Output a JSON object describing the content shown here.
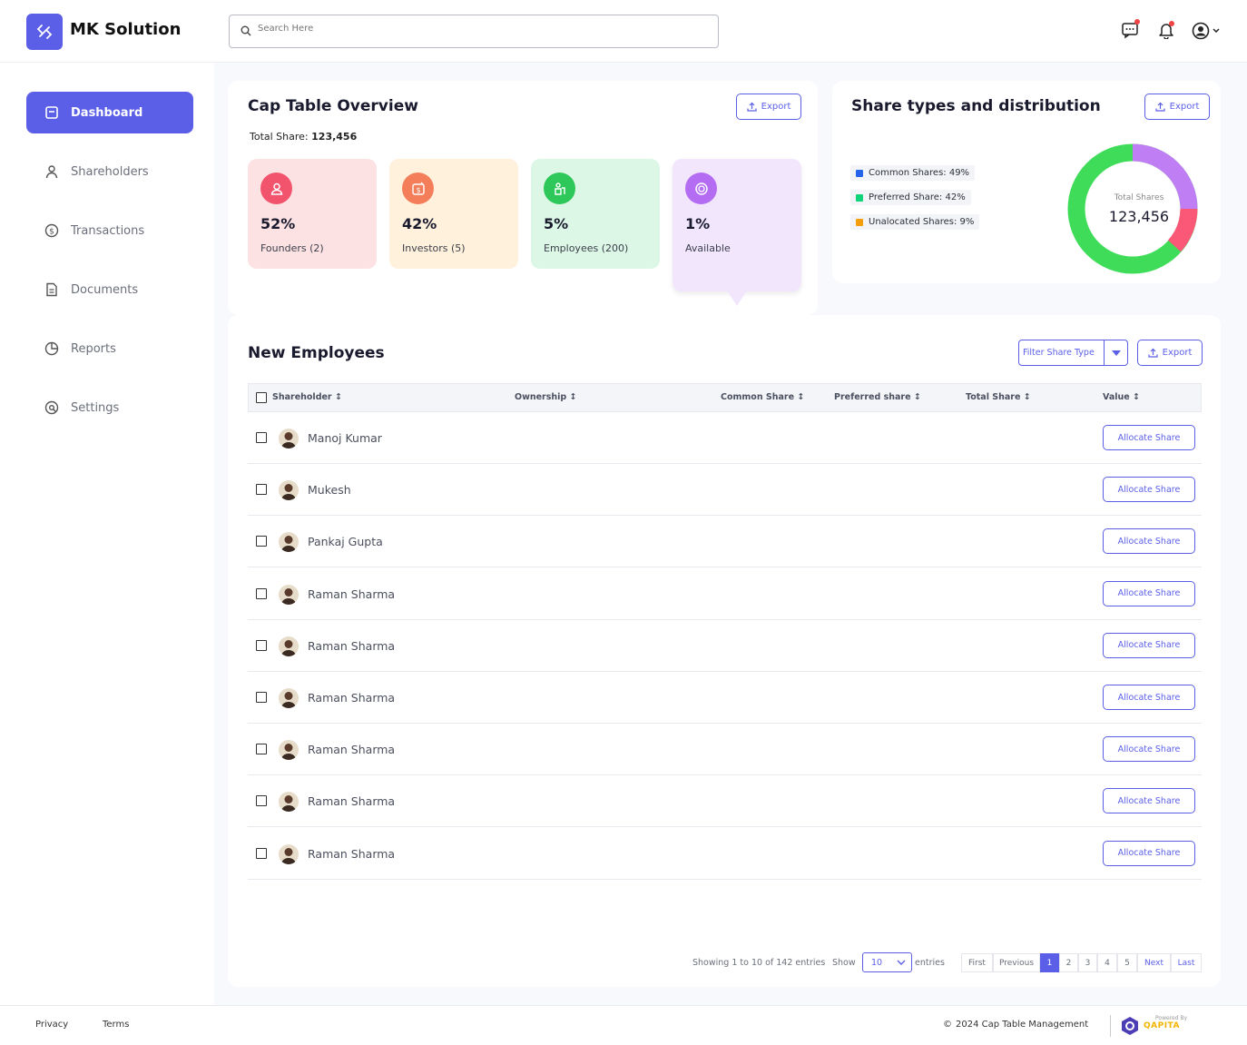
{
  "header": {
    "app_name": "MK Solution",
    "search_placeholder": "Search Here"
  },
  "sidebar": {
    "items": [
      {
        "label": "Dashboard",
        "icon": "dashboard-icon"
      },
      {
        "label": "Shareholders",
        "icon": "user-icon"
      },
      {
        "label": "Transactions",
        "icon": "dollar-circle-icon"
      },
      {
        "label": "Documents",
        "icon": "document-icon"
      },
      {
        "label": "Reports",
        "icon": "pie-chart-icon"
      },
      {
        "label": "Settings",
        "icon": "settings-icon"
      }
    ]
  },
  "overview": {
    "title": "Cap Table Overview",
    "export_label": "Export",
    "total_label": "Total Share:",
    "total_value": "123,456",
    "stats": [
      {
        "pct": "52%",
        "label": "Founders (2)"
      },
      {
        "pct": "42%",
        "label": "Investors (5)"
      },
      {
        "pct": "5%",
        "label": "Employees (200)"
      },
      {
        "pct": "1%",
        "label": "Available"
      }
    ]
  },
  "distribution": {
    "title": "Share types and distribution",
    "export_label": "Export",
    "legend": [
      {
        "label": "Common Shares: 49%",
        "color": "#2563eb"
      },
      {
        "label": "Preferred Share: 42%",
        "color": "#10d47a"
      },
      {
        "label": "Unalocated Shares: 9%",
        "color": "#f59e0b"
      }
    ],
    "center_label": "Total Shares",
    "center_value": "123,456"
  },
  "employees": {
    "title": "New Employees",
    "filter_label": "Filter Share Type",
    "export_label": "Export",
    "columns": [
      "Shareholder",
      "Ownership",
      "Common Share",
      "Preferred share",
      "Total Share",
      "Value"
    ],
    "allocate_label": "Allocate Share",
    "rows": [
      "Manoj Kumar",
      "Mukesh",
      "Pankaj Gupta",
      "Raman Sharma",
      "Raman Sharma",
      "Raman Sharma",
      "Raman Sharma",
      "Raman Sharma",
      "Raman Sharma"
    ]
  },
  "pagination": {
    "showing": "Showing 1 to 10 of 142 entries",
    "show": "Show",
    "page_size": "10",
    "entries": "entries",
    "first": "First",
    "previous": "Previous",
    "pages": [
      "1",
      "2",
      "3",
      "4",
      "5"
    ],
    "next": "Next",
    "last": "Last"
  },
  "footer": {
    "privacy": "Privacy",
    "terms": "Terms",
    "copyright": "2024 Cap Table Management",
    "powered_by": "Powered By",
    "brand": "QAPITA"
  }
}
